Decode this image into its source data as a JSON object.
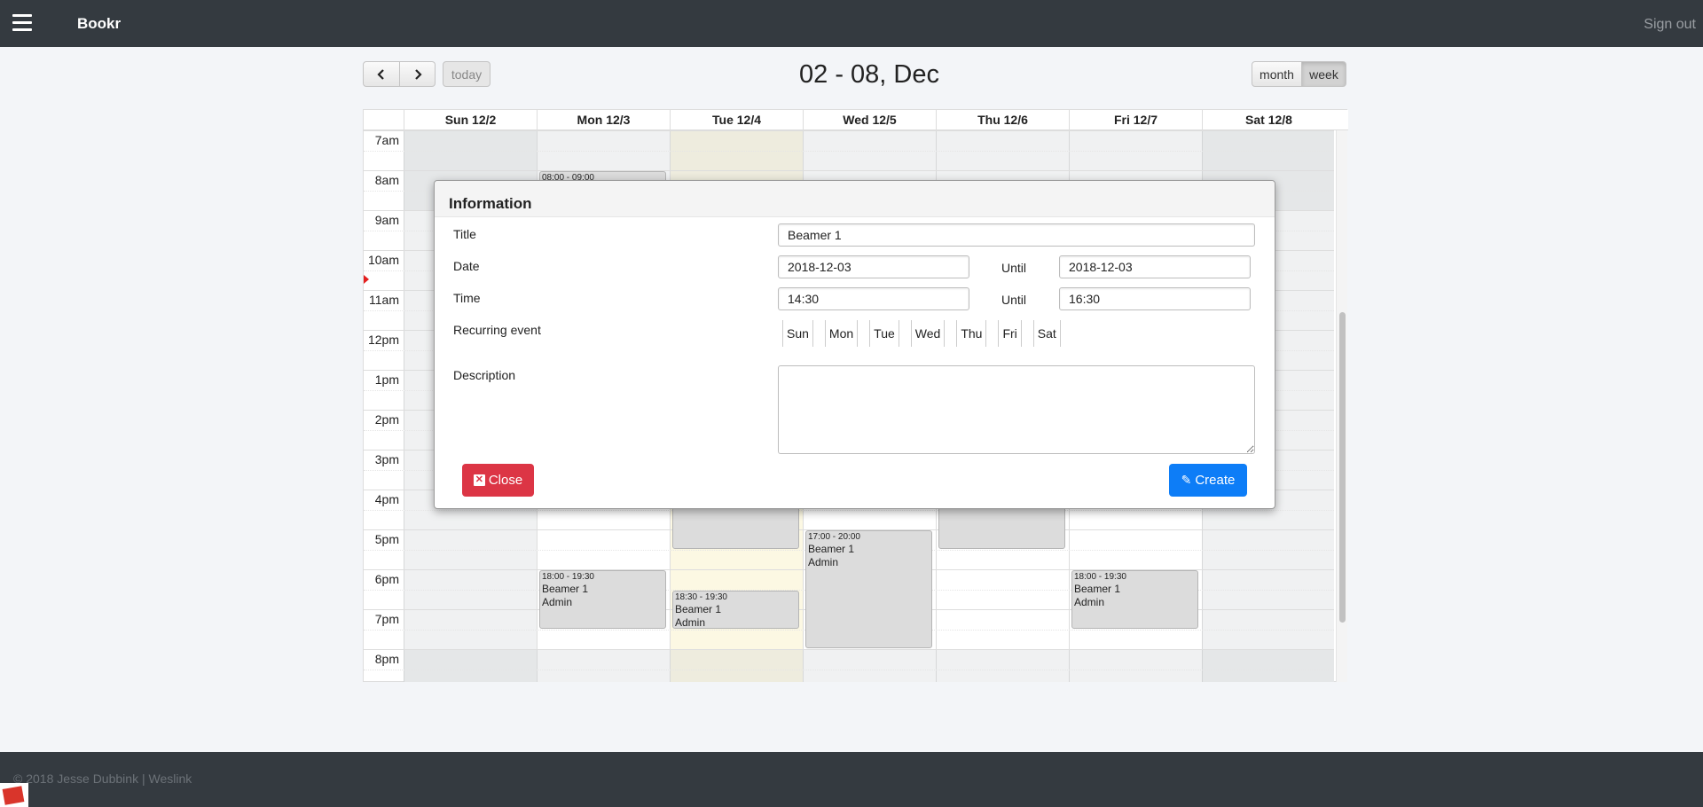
{
  "navbar": {
    "brand": "Bookr",
    "sign_out": "Sign out",
    "menu_icon": "hamburger-icon"
  },
  "toolbar": {
    "prev_icon": "‹",
    "next_icon": "›",
    "today_label": "today",
    "title": "02 - 08, Dec",
    "month_label": "month",
    "week_label": "week",
    "active_view": "week"
  },
  "calendar": {
    "days": [
      "Sun 12/2",
      "Mon 12/3",
      "Tue 12/4",
      "Wed 12/5",
      "Thu 12/6",
      "Fri 12/7",
      "Sat 12/8"
    ],
    "today_index": 2,
    "hours": [
      "7am",
      "8am",
      "9am",
      "10am",
      "11am",
      "12pm",
      "1pm",
      "2pm",
      "3pm",
      "4pm",
      "5pm",
      "6pm",
      "7pm",
      "8pm"
    ],
    "events": [
      {
        "day": 1,
        "start": 8.0,
        "end": 9.0,
        "time": "08:00 - 09:00",
        "title": "",
        "user": ""
      },
      {
        "day": 2,
        "start": 16.0,
        "end": 17.5,
        "time": "",
        "title": "",
        "user": ""
      },
      {
        "day": 4,
        "start": 16.0,
        "end": 17.5,
        "time": "",
        "title": "",
        "user": ""
      },
      {
        "day": 3,
        "start": 17.0,
        "end": 20.0,
        "time": "17:00 - 20:00",
        "title": "Beamer 1",
        "user": "Admin"
      },
      {
        "day": 1,
        "start": 18.0,
        "end": 19.5,
        "time": "18:00 - 19:30",
        "title": "Beamer 1",
        "user": "Admin"
      },
      {
        "day": 2,
        "start": 18.5,
        "end": 19.5,
        "time": "18:30 - 19:30",
        "title": "Beamer 1",
        "user": "Admin"
      },
      {
        "day": 5,
        "start": 18.0,
        "end": 19.5,
        "time": "18:00 - 19:30",
        "title": "Beamer 1",
        "user": "Admin"
      }
    ],
    "colors": {
      "today_bg": "#fcf8e3",
      "past_bg": "#eef0f1",
      "event_bg": "#dcdcdc",
      "now_indicator": "#e41e1e"
    }
  },
  "modal": {
    "title": "Information",
    "fields": {
      "title_label": "Title",
      "title_value": "Beamer 1",
      "date_label": "Date",
      "date_value": "2018-12-03",
      "date_until_label": "Until",
      "date_until_value": "2018-12-03",
      "time_label": "Time",
      "time_value": "14:30",
      "time_until_label": "Until",
      "time_until_value": "16:30",
      "recurring_label": "Recurring event",
      "recurring_days": [
        "Sun",
        "Mon",
        "Tue",
        "Wed",
        "Thu",
        "Fri",
        "Sat"
      ],
      "description_label": "Description",
      "description_value": ""
    },
    "close_label": "Close",
    "create_label": "Create",
    "close_color": "#dc3545",
    "create_color": "#0d7df7"
  },
  "footer": {
    "text": "© 2018 Jesse Dubbink | Weslink"
  }
}
